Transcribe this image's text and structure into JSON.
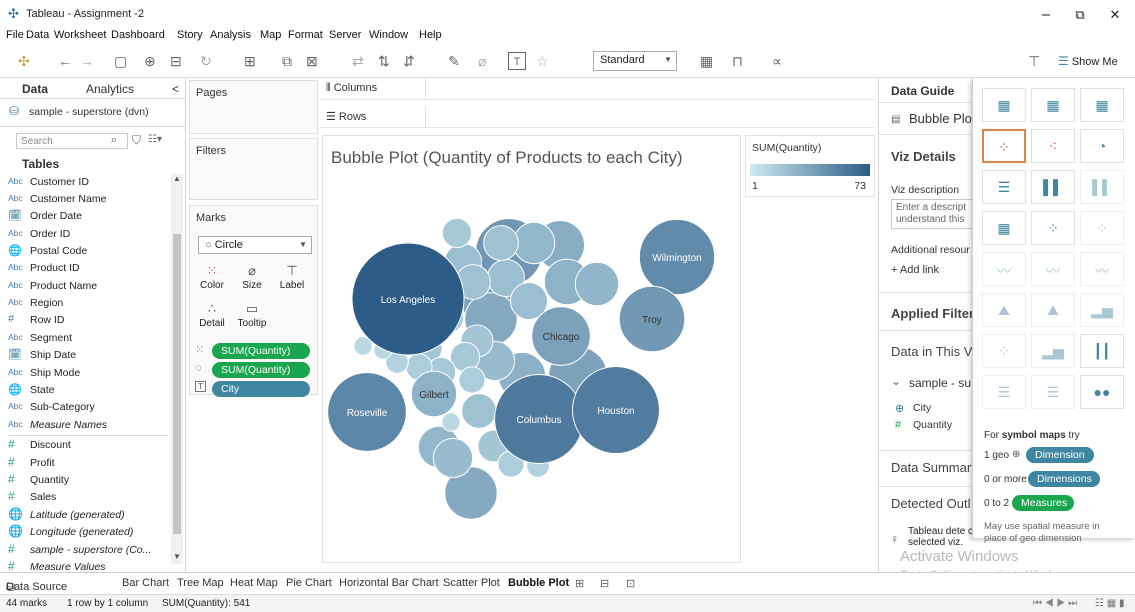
{
  "window": {
    "title": "Tableau - Assignment -2",
    "minimize": "–",
    "maximize": "⧉",
    "close": "✕"
  },
  "menu": [
    "File",
    "Data",
    "Worksheet",
    "Dashboard",
    "Story",
    "Analysis",
    "Map",
    "Format",
    "Server",
    "Window",
    "Help"
  ],
  "toolbar": {
    "fit_select": "Standard",
    "show_me_label": "Show Me"
  },
  "data_pane": {
    "tab_data": "Data",
    "tab_analytics": "Analytics",
    "collapse": "<",
    "datasource": "sample - superstore (dvn)",
    "search_placeholder": "Search",
    "tables_label": "Tables",
    "fields": [
      {
        "type": "Abc",
        "name": "Customer ID"
      },
      {
        "type": "Abc",
        "name": "Customer Name"
      },
      {
        "type": "🗓",
        "name": "Order Date"
      },
      {
        "type": "Abc",
        "name": "Order ID"
      },
      {
        "type": "🌐",
        "name": "Postal Code"
      },
      {
        "type": "Abc",
        "name": "Product ID"
      },
      {
        "type": "Abc",
        "name": "Product Name"
      },
      {
        "type": "Abc",
        "name": "Region"
      },
      {
        "type": "#",
        "name": "Row ID"
      },
      {
        "type": "Abc",
        "name": "Segment"
      },
      {
        "type": "🗓",
        "name": "Ship Date"
      },
      {
        "type": "Abc",
        "name": "Ship Mode"
      },
      {
        "type": "🌐",
        "name": "State"
      },
      {
        "type": "Abc",
        "name": "Sub-Category"
      },
      {
        "type": "Abc",
        "name": "Measure Names"
      },
      {
        "type": "#",
        "name": "Discount"
      },
      {
        "type": "#",
        "name": "Profit"
      },
      {
        "type": "#",
        "name": "Quantity"
      },
      {
        "type": "#",
        "name": "Sales"
      },
      {
        "type": "🌐",
        "name": "Latitude (generated)"
      },
      {
        "type": "🌐",
        "name": "Longitude (generated)"
      },
      {
        "type": "#",
        "name": "sample - superstore (Co..."
      },
      {
        "type": "#",
        "name": "Measure Values"
      }
    ]
  },
  "cards": {
    "pages": "Pages",
    "filters": "Filters",
    "marks": "Marks",
    "mark_type": "Circle",
    "buttons": [
      "Color",
      "Size",
      "Label",
      "Detail",
      "Tooltip"
    ],
    "pills": [
      {
        "icon": "⁙",
        "label": "SUM(Quantity)",
        "color": "#1aa64f"
      },
      {
        "icon": "◌",
        "label": "SUM(Quantity)",
        "color": "#1aa64f"
      },
      {
        "icon": "T",
        "label": "City",
        "color": "#3f86a2"
      }
    ]
  },
  "shelves": {
    "columns": "Columns",
    "rows": "Rows"
  },
  "viz": {
    "title": "Bubble Plot (Quantity of Products to each City)",
    "legend_title": "SUM(Quantity)",
    "legend_min": "1",
    "legend_max": "73"
  },
  "chart_data": {
    "type": "bubble",
    "title": "Bubble Plot (Quantity of Products to each City)",
    "size_measure": "SUM(Quantity)",
    "color_range": [
      1,
      73
    ],
    "labeled": [
      {
        "city": "Los Angeles",
        "value": 73
      },
      {
        "city": "Columbus",
        "value": 46
      },
      {
        "city": "Houston",
        "value": 44
      },
      {
        "city": "Roseville",
        "value": 36
      },
      {
        "city": "Wilmington",
        "value": 33
      },
      {
        "city": "Troy",
        "value": 25
      },
      {
        "city": "Chicago",
        "value": 20
      },
      {
        "city": "Gilbert",
        "value": 12
      }
    ],
    "unlabeled_values": [
      26,
      20,
      18,
      16,
      16,
      14,
      13,
      12,
      11,
      10,
      10,
      9,
      9,
      8,
      8,
      8,
      7,
      7,
      7,
      6,
      6,
      6,
      5,
      5,
      5,
      5,
      4,
      4,
      4,
      3,
      3,
      3,
      2,
      2,
      2,
      2
    ],
    "marks_total": 44,
    "sum_total": 541
  },
  "guide": {
    "title": "Data Guide",
    "chart_name": "Bubble Plo",
    "viz_details": "Viz Details",
    "viz_description": "Viz description",
    "desc_placeholder": "Enter a descript understand this",
    "additional": "Additional resour",
    "add_link": "+  Add link",
    "applied_filters": "Applied Filter:",
    "data_in_view": "Data in This V",
    "source": "sample - su",
    "city": "City",
    "quantity": "Quantity",
    "summary": "Data Summary",
    "outliers": "Detected Outl",
    "outlier_text": "Tableau dete compared to other marks in the selected viz."
  },
  "show_me": {
    "note_prefix": "For ",
    "note_bold": "symbol maps",
    "note_suffix": " try",
    "geo_count": "1 geo",
    "dimension_pill": "Dimension",
    "or_more": "0 or more",
    "dimensions_pill": "Dimensions",
    "zero_to_two": "0 to 2",
    "measures_pill": "Measures",
    "hint": "May use spatial measure in place of geo dimension"
  },
  "sheets": {
    "datasource": "Data Source",
    "tabs": [
      "Bar Chart",
      "Tree Map",
      "Heat Map",
      "Pie Chart",
      "Horizontal Bar Chart",
      "Scatter Plot",
      "Bubble Plot"
    ]
  },
  "status": {
    "marks": "44 marks",
    "layout": "1 row by 1 column",
    "sum": "SUM(Quantity): 541"
  },
  "watermark": {
    "line1": "Activate Windows",
    "line2": "Go to Settings to activate Windows."
  },
  "colors": {
    "pill_green": "#1aa64f",
    "pill_blue": "#3f86a2",
    "bubble_dark": "#2d5c88",
    "bubble_light": "#cdeaf0"
  }
}
